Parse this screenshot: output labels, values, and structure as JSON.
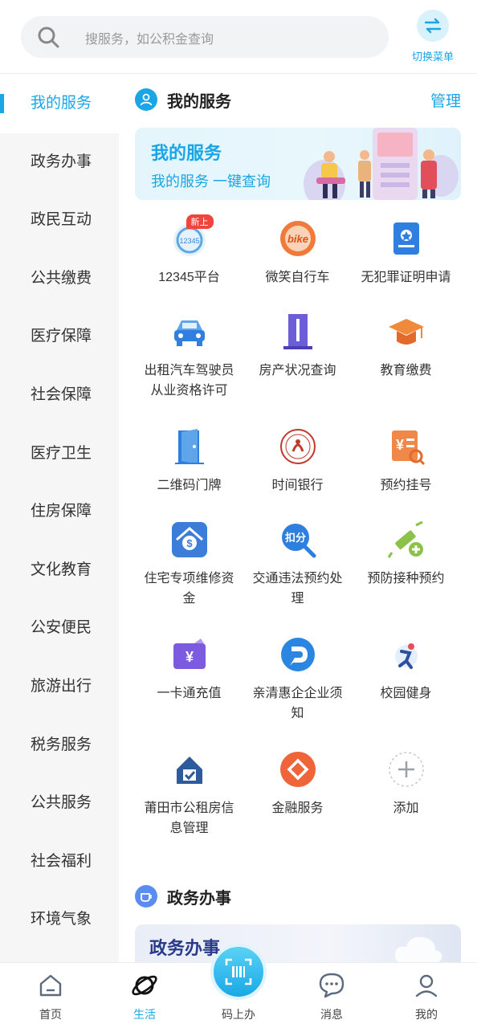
{
  "search": {
    "placeholder": "搜服务，如公积金查询"
  },
  "switch_menu": {
    "label": "切换菜单"
  },
  "sidebar": {
    "items": [
      {
        "label": "我的服务",
        "active": true
      },
      {
        "label": "政务办事"
      },
      {
        "label": "政民互动"
      },
      {
        "label": "公共缴费"
      },
      {
        "label": "医疗保障"
      },
      {
        "label": "社会保障"
      },
      {
        "label": "医疗卫生"
      },
      {
        "label": "住房保障"
      },
      {
        "label": "文化教育"
      },
      {
        "label": "公安便民"
      },
      {
        "label": "旅游出行"
      },
      {
        "label": "税务服务"
      },
      {
        "label": "公共服务"
      },
      {
        "label": "社会福利"
      },
      {
        "label": "环境气象"
      }
    ]
  },
  "my_services": {
    "title": "我的服务",
    "manage_label": "管理",
    "banner_title": "我的服务",
    "banner_subtitle": "我的服务 一键查询",
    "items": [
      {
        "label": "12345平台",
        "badge": "新上",
        "icon": "12345-icon"
      },
      {
        "label": "微笑自行车",
        "icon": "smile-bike-icon"
      },
      {
        "label": "无犯罪证明申请",
        "icon": "certificate-icon"
      },
      {
        "label": "出租汽车驾驶员从业资格许可",
        "icon": "taxi-icon"
      },
      {
        "label": "房产状况查询",
        "icon": "building-icon"
      },
      {
        "label": "教育缴费",
        "icon": "graduation-cap-icon"
      },
      {
        "label": "二维码门牌",
        "icon": "door-icon"
      },
      {
        "label": "时间银行",
        "icon": "time-bank-icon"
      },
      {
        "label": "预约挂号",
        "icon": "registration-icon"
      },
      {
        "label": "住宅专项维修资金",
        "icon": "house-fund-icon"
      },
      {
        "label": "交通违法预约处理",
        "icon": "traffic-points-icon"
      },
      {
        "label": "预防接种预约",
        "icon": "vaccine-icon"
      },
      {
        "label": "一卡通充值",
        "icon": "card-recharge-icon"
      },
      {
        "label": "亲清惠企企业须知",
        "icon": "enterprise-icon"
      },
      {
        "label": "校园健身",
        "icon": "sports-icon"
      },
      {
        "label": "莆田市公租房信息管理",
        "icon": "public-housing-icon"
      },
      {
        "label": "金融服务",
        "icon": "finance-icon"
      },
      {
        "label": "添加",
        "icon": "add-icon"
      }
    ]
  },
  "gov_affairs": {
    "title": "政务办事",
    "banner_title": "政务办事"
  },
  "bottom_nav": {
    "items": [
      {
        "label": "首页",
        "icon": "home-icon"
      },
      {
        "label": "生活",
        "icon": "planet-icon",
        "active": true
      },
      {
        "label": "码上办",
        "icon": "scan-code-icon"
      },
      {
        "label": "消息",
        "icon": "message-icon"
      },
      {
        "label": "我的",
        "icon": "profile-icon"
      }
    ]
  },
  "colors": {
    "accent": "#1aa6e6",
    "badge": "#f0443c"
  }
}
